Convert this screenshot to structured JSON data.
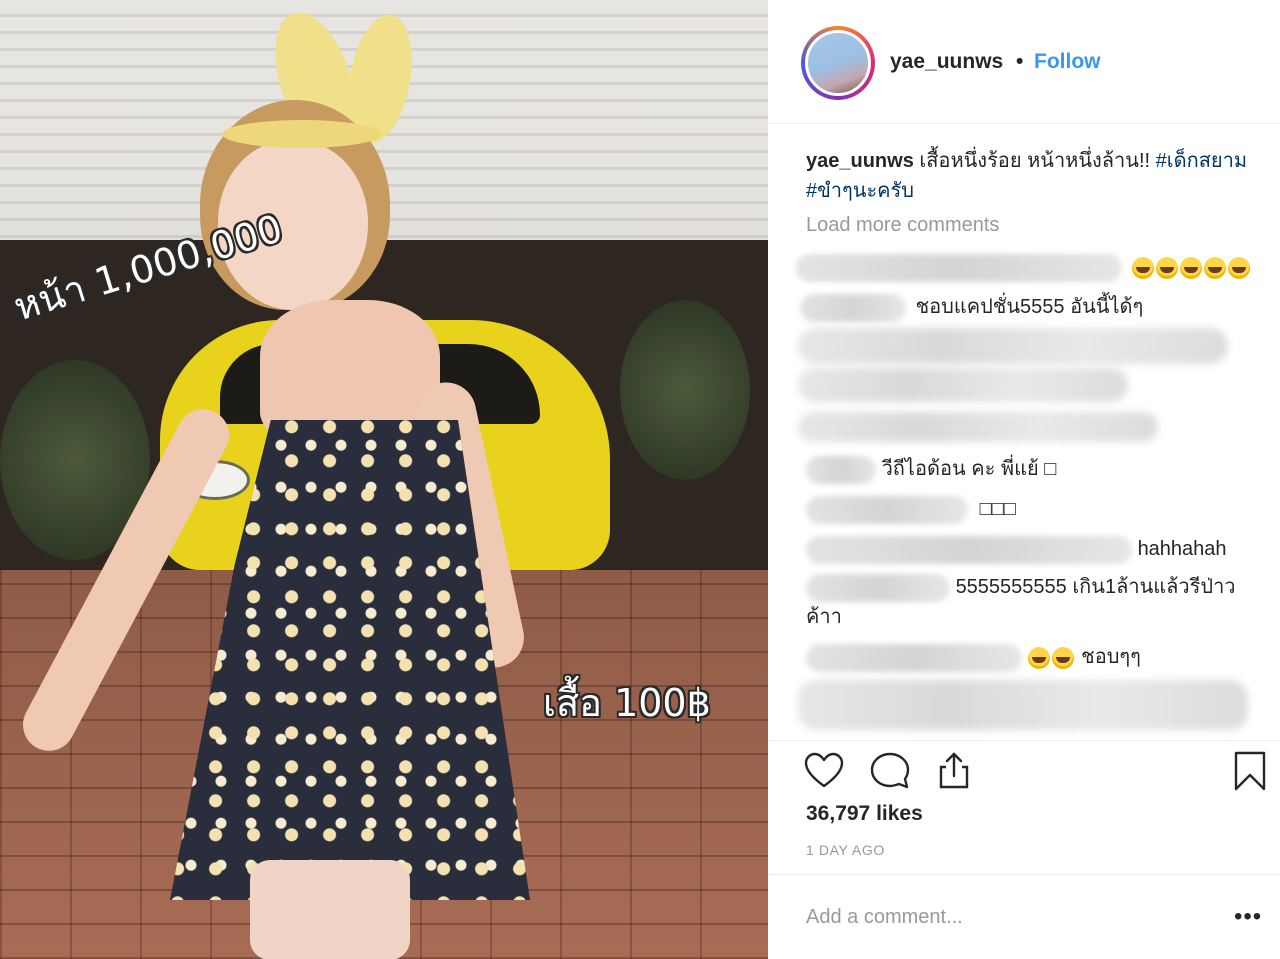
{
  "post": {
    "image_overlay": {
      "face_price": "หน้า 1,000,000",
      "shirt_price": "เสื้อ 100฿"
    }
  },
  "header": {
    "username": "yae_uunws",
    "separator": "•",
    "follow_label": "Follow"
  },
  "caption": {
    "username": "yae_uunws",
    "text": "เสื้อหนึ่งร้อย หน้าหนึ่งล้าน!!",
    "hashtag_1": "#เด็กสยาม",
    "hashtag_2": "#ขำๆนะครับ"
  },
  "comments": {
    "load_more": "Load more comments",
    "items": [
      {
        "text": ""
      },
      {
        "text": "ชอบแคปชั่น5555 อันนี้ได้ๆ"
      },
      {
        "text": "วีถีไอด้อน คะ พี่แย้ □"
      },
      {
        "text": "□□□"
      },
      {
        "text": "hahhahah"
      },
      {
        "text": "5555555555 เกิน1ล้านแล้วรีป่าวค้าา"
      },
      {
        "text": "ชอบๆๆ"
      }
    ]
  },
  "actions": {
    "icons": [
      "heart-icon",
      "comment-icon",
      "share-icon",
      "bookmark-icon"
    ],
    "likes": "36,797 likes",
    "timestamp": "1 DAY AGO",
    "add_comment_placeholder": "Add a comment...",
    "more_label": "•••"
  },
  "colors": {
    "link": "#3897f0",
    "hashtag": "#003569",
    "muted": "#999999",
    "text": "#262626",
    "border": "#efefef"
  }
}
